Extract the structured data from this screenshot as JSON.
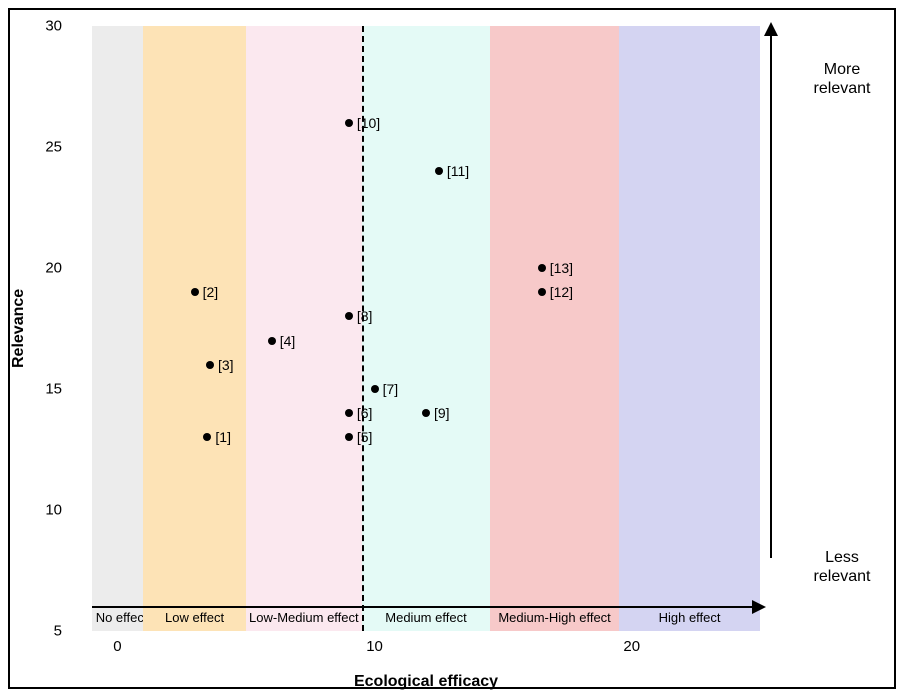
{
  "chart_data": {
    "type": "scatter",
    "xlabel": "Ecological efficacy",
    "ylabel": "Relevance",
    "xlim": [
      -2,
      26
    ],
    "ylim": [
      5,
      30
    ],
    "x_ticks": [
      0,
      10,
      20
    ],
    "y_ticks": [
      5,
      10,
      15,
      20,
      25,
      30
    ],
    "bands": [
      {
        "label": "No effect",
        "x0": -1,
        "x1": 1,
        "color": "#ececec"
      },
      {
        "label": "Low effect",
        "x0": 1,
        "x1": 5,
        "color": "#fde3b6"
      },
      {
        "label": "Low-Medium effect",
        "x0": 5,
        "x1": 9.5,
        "color": "#fbe8ef"
      },
      {
        "label": "Medium effect",
        "x0": 9.5,
        "x1": 14.5,
        "color": "#e4faf6"
      },
      {
        "label": "Medium-High effect",
        "x0": 14.5,
        "x1": 19.5,
        "color": "#f7c9c9"
      },
      {
        "label": "High effect",
        "x0": 19.5,
        "x1": 25,
        "color": "#d4d4f2"
      }
    ],
    "vline_x": 9.5,
    "points": [
      {
        "id": "[1]",
        "x": 3.5,
        "y": 13
      },
      {
        "id": "[2]",
        "x": 3.0,
        "y": 19
      },
      {
        "id": "[3]",
        "x": 3.6,
        "y": 16
      },
      {
        "id": "[4]",
        "x": 6.0,
        "y": 17
      },
      {
        "id": "[5]",
        "x": 9.0,
        "y": 13
      },
      {
        "id": "[6]",
        "x": 9.0,
        "y": 14
      },
      {
        "id": "[7]",
        "x": 10.0,
        "y": 15
      },
      {
        "id": "[8]",
        "x": 9.0,
        "y": 18
      },
      {
        "id": "[9]",
        "x": 12.0,
        "y": 14
      },
      {
        "id": "[10]",
        "x": 9.0,
        "y": 26
      },
      {
        "id": "[11]",
        "x": 12.5,
        "y": 24
      },
      {
        "id": "[12]",
        "x": 16.5,
        "y": 19
      },
      {
        "id": "[13]",
        "x": 16.5,
        "y": 20
      }
    ],
    "side_labels": {
      "top": "More relevant",
      "bottom": "Less relevant"
    }
  }
}
